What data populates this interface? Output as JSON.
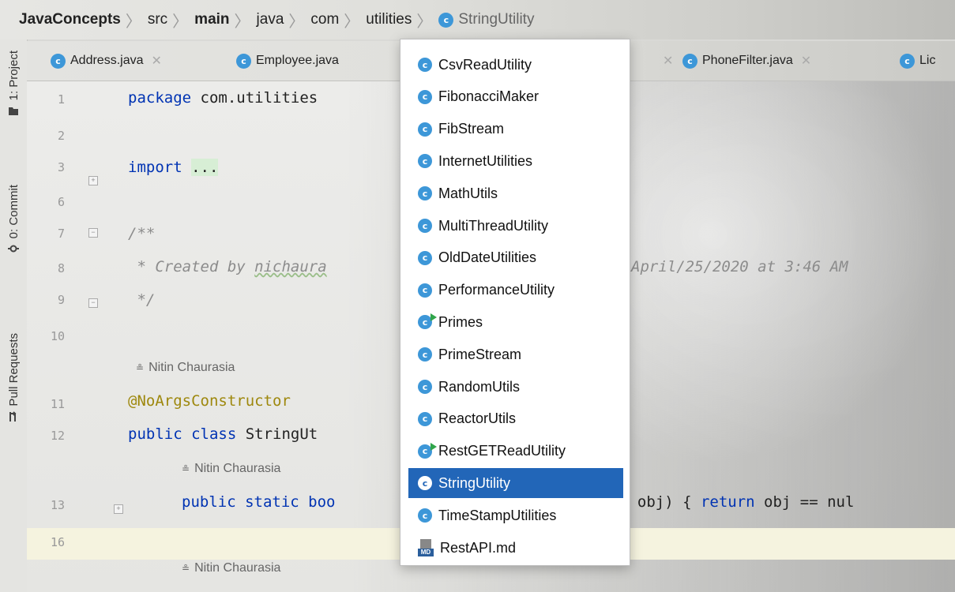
{
  "breadcrumb": {
    "items": [
      "JavaConcepts",
      "src",
      "main",
      "java",
      "com",
      "utilities"
    ],
    "current": "StringUtility"
  },
  "side_tabs": [
    "1: Project",
    "0: Commit",
    "Pull Requests"
  ],
  "tabs": [
    {
      "label": "Address.java",
      "closable": true
    },
    {
      "label": "Employee.java",
      "closable": false
    },
    {
      "label": "PhoneFilter.java",
      "closable": true
    },
    {
      "label": "Lic",
      "closable": false
    }
  ],
  "gutter": {
    "line_numbers": [
      "1",
      "2",
      "3",
      "6",
      "7",
      "8",
      "9",
      "10",
      "11",
      "12",
      "13",
      "16"
    ]
  },
  "code": {
    "l1_kw": "package",
    "l1_rest": "com.utilities",
    "l3_kw": "import",
    "l3_fold": "...",
    "l7": "/**",
    "l8_a": " * Created by ",
    "l8_b": "nichaura",
    "l8_c": "April/25/2020 at 3:46 AM",
    "l9": " */",
    "author1": "Nitin Chaurasia",
    "l11": "@NoArgsConstructor",
    "l12_kw": "public class",
    "l12_rest": "StringUt",
    "author2": "Nitin Chaurasia",
    "l13_kw": "public static boo",
    "l13_rest": "g obj) { ",
    "l13_kw2": "return",
    "l13_rest2": " obj == nul",
    "author3": "Nitin Chaurasia"
  },
  "popup": {
    "items": [
      {
        "label": "CsvReadUtility",
        "icon": "class-icon",
        "runnable": false
      },
      {
        "label": "FibonacciMaker",
        "icon": "class-icon",
        "runnable": false
      },
      {
        "label": "FibStream",
        "icon": "class-icon",
        "runnable": false
      },
      {
        "label": "InternetUtilities",
        "icon": "class-icon",
        "runnable": false
      },
      {
        "label": "MathUtils",
        "icon": "class-icon",
        "runnable": false
      },
      {
        "label": "MultiThreadUtility",
        "icon": "class-icon",
        "runnable": false
      },
      {
        "label": "OldDateUtilities",
        "icon": "class-icon",
        "runnable": false
      },
      {
        "label": "PerformanceUtility",
        "icon": "class-icon",
        "runnable": false
      },
      {
        "label": "Primes",
        "icon": "class-icon",
        "runnable": true
      },
      {
        "label": "PrimeStream",
        "icon": "class-icon",
        "runnable": false
      },
      {
        "label": "RandomUtils",
        "icon": "class-icon",
        "runnable": false
      },
      {
        "label": "ReactorUtils",
        "icon": "class-icon",
        "runnable": false
      },
      {
        "label": "RestGETReadUtility",
        "icon": "class-icon",
        "runnable": true
      },
      {
        "label": "StringUtility",
        "icon": "class-icon",
        "runnable": false,
        "selected": true
      },
      {
        "label": "TimeStampUtilities",
        "icon": "class-icon",
        "runnable": false
      },
      {
        "label": "RestAPI.md",
        "icon": "markdown-file-icon",
        "runnable": false
      }
    ],
    "class_icon_letter": "c",
    "md_tag": "MD"
  },
  "colors": {
    "class_icon": "#3d97d8",
    "selection": "#2266b8",
    "keyword": "#0033b3",
    "annotation": "#9e880d"
  }
}
